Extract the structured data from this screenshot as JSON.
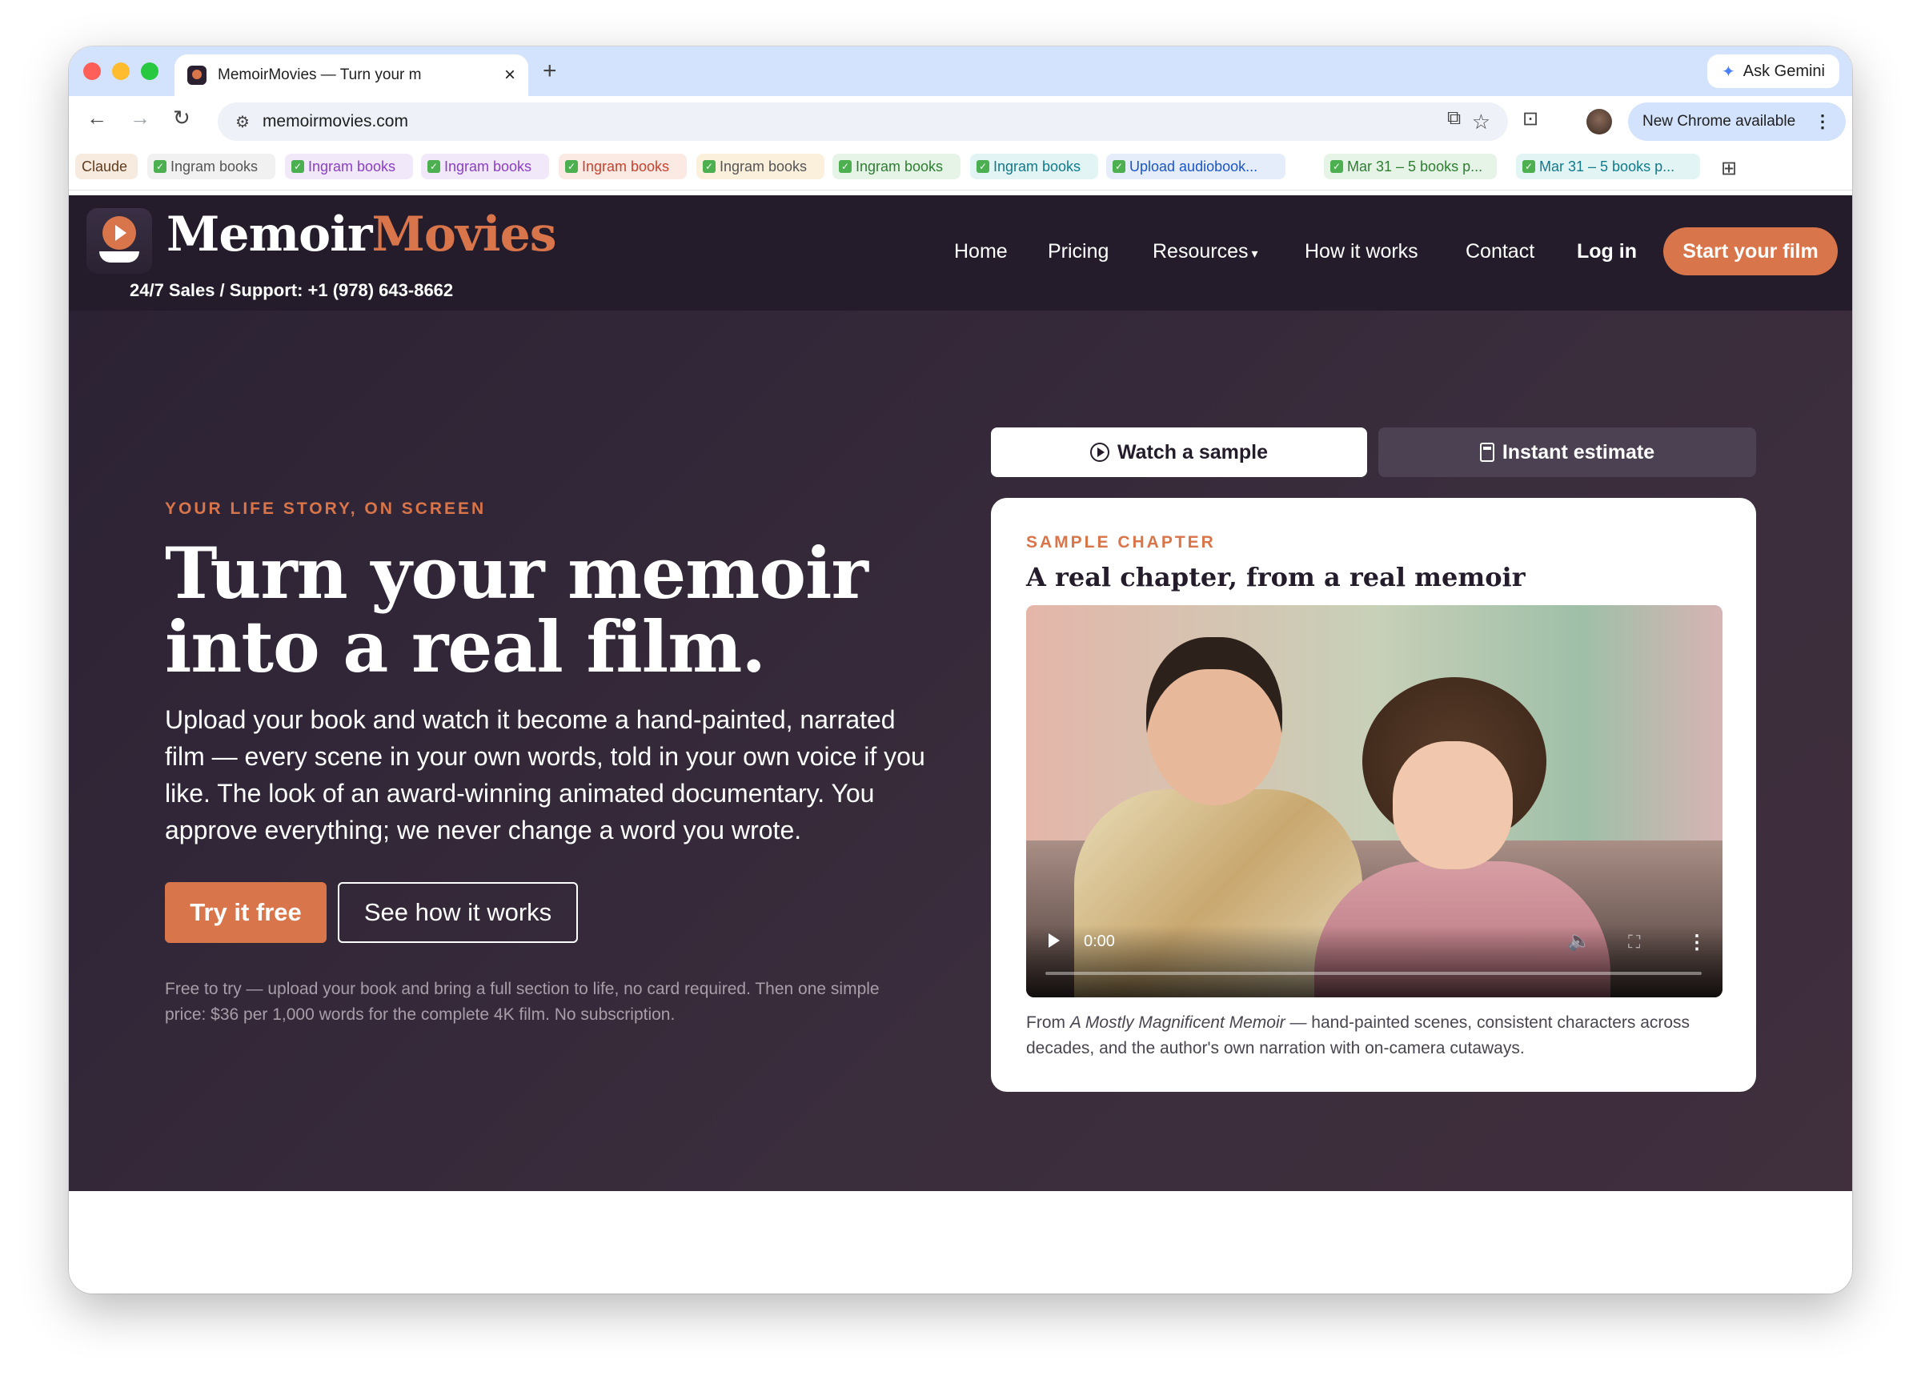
{
  "browser": {
    "tab_title": "MemoirMovies — Turn your m",
    "new_tab": "+",
    "close": "×",
    "ask_gemini": "Ask Gemini",
    "url": "memoirmovies.com",
    "chrome_update": "New Chrome available",
    "bookmarks": [
      {
        "label": "Claude",
        "color": "#5f3b1f",
        "bg": "#f7ebe0",
        "check": false
      },
      {
        "label": "Ingram books",
        "color": "#555555",
        "bg": "#f1f1f1",
        "check": true
      },
      {
        "label": "Ingram books",
        "color": "#8a3fc4",
        "bg": "#f1e8fa",
        "check": true
      },
      {
        "label": "Ingram books",
        "color": "#8a3fc4",
        "bg": "#f1e8fa",
        "check": true
      },
      {
        "label": "Ingram books",
        "color": "#c5432f",
        "bg": "#fbe9e4",
        "check": true
      },
      {
        "label": "Ingram books",
        "color": "#555555",
        "bg": "#fbf0dc",
        "check": true
      },
      {
        "label": "Ingram books",
        "color": "#2e7d32",
        "bg": "#e6f4e7",
        "check": true
      },
      {
        "label": "Ingram books",
        "color": "#117a8b",
        "bg": "#e3f4f4",
        "check": true
      },
      {
        "label": "Upload audiobook...",
        "color": "#1a56c4",
        "bg": "#e5edfb",
        "check": true
      },
      {
        "label": "Mar 31 – 5 books p...",
        "color": "#2e7d32",
        "bg": "#e6f4e7",
        "check": true
      },
      {
        "label": "Mar 31 – 5 books p...",
        "color": "#117a8b",
        "bg": "#e3f4f4",
        "check": true
      }
    ]
  },
  "site": {
    "logo_memoir": "Memoir",
    "logo_movies": "Movies",
    "support": "24/7 Sales / Support: +1 (978) 643-8662",
    "nav": {
      "home": "Home",
      "pricing": "Pricing",
      "resources": "Resources",
      "how": "How it works",
      "contact": "Contact",
      "login": "Log in",
      "start": "Start your film"
    }
  },
  "hero": {
    "eyebrow": "YOUR LIFE STORY, ON SCREEN",
    "headline": "Turn your memoir into a real film.",
    "subhead": "Upload your book and watch it become a hand-painted, narrated film — every scene in your own words, told in your own voice if you like. The look of an award-winning animated documentary. You approve everything; we never change a word you wrote.",
    "try_free": "Try it free",
    "see_how": "See how it works",
    "fineprint": "Free to try — upload your book and bring a full section to life, no card required. Then one simple price: $36 per 1,000 words for the complete 4K film. No subscription."
  },
  "sample": {
    "tab_watch": "Watch a sample",
    "tab_estimate": "Instant estimate",
    "eyebrow": "SAMPLE CHAPTER",
    "title": "A real chapter, from a real memoir",
    "video_time": "0:00",
    "caption_prefix": "From ",
    "caption_book": "A Mostly Magnificent Memoir",
    "caption_rest": " — hand-painted scenes, consistent characters across decades, and the author's own narration with on-camera cutaways."
  }
}
